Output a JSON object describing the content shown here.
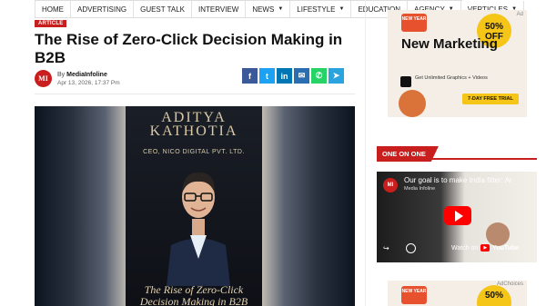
{
  "nav": {
    "items": [
      {
        "label": "HOME",
        "dropdown": false
      },
      {
        "label": "ADVERTISING",
        "dropdown": false
      },
      {
        "label": "GUEST TALK",
        "dropdown": false
      },
      {
        "label": "INTERVIEW",
        "dropdown": false
      },
      {
        "label": "NEWS",
        "dropdown": true
      },
      {
        "label": "LIFESTYLE",
        "dropdown": true
      },
      {
        "label": "EDUCATION",
        "dropdown": false
      },
      {
        "label": "AGENCY",
        "dropdown": true
      },
      {
        "label": "VERTICLES",
        "dropdown": true
      }
    ]
  },
  "article": {
    "badge": "ARTICLE",
    "title": "The Rise of Zero-Click Decision Making in B2B",
    "author_prefix": "By",
    "author": "MediaInfoline",
    "date": "Apr 13, 2026, 17:37 Pm",
    "avatar_text": "MI"
  },
  "share": {
    "icons": [
      {
        "name": "facebook-icon",
        "glyph": "f",
        "color": "#3b5998"
      },
      {
        "name": "twitter-icon",
        "glyph": "t",
        "color": "#1da1f2"
      },
      {
        "name": "linkedin-icon",
        "glyph": "in",
        "color": "#0077b5"
      },
      {
        "name": "email-icon",
        "glyph": "✉",
        "color": "#2a6db0"
      },
      {
        "name": "whatsapp-icon",
        "glyph": "✆",
        "color": "#25d366"
      },
      {
        "name": "telegram-icon",
        "glyph": "➤",
        "color": "#2aa3df"
      }
    ]
  },
  "hero": {
    "name": "ADITYA KATHOTIA",
    "role": "CEO, NICO DIGITAL PVT. LTD.",
    "headline": "The Rise of Zero-Click Decision Making in B2B"
  },
  "ad": {
    "new_year": "NEW YEAR",
    "offer": "50% OFF",
    "headline": "New Marketing",
    "copy": "Get Unlimited Graphics + Videos",
    "trial": "7-DAY FREE TRIAL",
    "ad_mark": "Ad"
  },
  "sidebar": {
    "section_title": "ONE ON ONE",
    "video": {
      "title": "Our goal is to make India fitter: Ar",
      "channel": "Media Infoline",
      "channel_badge": "MI",
      "watch_on": "Watch on",
      "youtube": "YouTube"
    }
  },
  "ad2": {
    "new_year": "NEW YEAR",
    "offer": "50%",
    "ad_mark": "AdChoices"
  }
}
